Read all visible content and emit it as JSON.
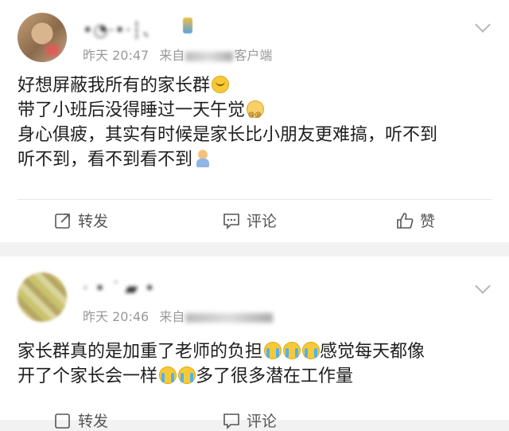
{
  "posts": [
    {
      "username": "•◔·•‧┆、",
      "time": "昨天 20:47",
      "source_prefix": "来自",
      "source_suffix": "客户端",
      "lines": [
        "好想屏蔽我所有的家长群",
        "带了小班后没得睡过一天午觉",
        "身心俱疲，其实有时候是家长比小朋友更难搞，听不到",
        "听不到，看不到看不到"
      ],
      "emojis": [
        "smile-emoji",
        "dizzy-emoji",
        "baby-emoji"
      ],
      "actions": {
        "repost": "转发",
        "comment": "评论",
        "like": "赞"
      }
    },
    {
      "username": "‧ • ˙ ▰ •",
      "time": "昨天 20:46",
      "source_prefix": "来自",
      "lines": [
        "家长群真的是加重了老师的负担",
        "感觉每天都像",
        "开了个家长会一样",
        "多了很多潜在工作量"
      ],
      "emojis": [
        "laugh-cry-emoji"
      ],
      "actions": {
        "repost": "转发",
        "comment": "评论"
      }
    }
  ],
  "colors": {
    "background": "#f2f2f2",
    "card": "#ffffff",
    "meta": "#999999",
    "text": "#1e1e1e"
  }
}
